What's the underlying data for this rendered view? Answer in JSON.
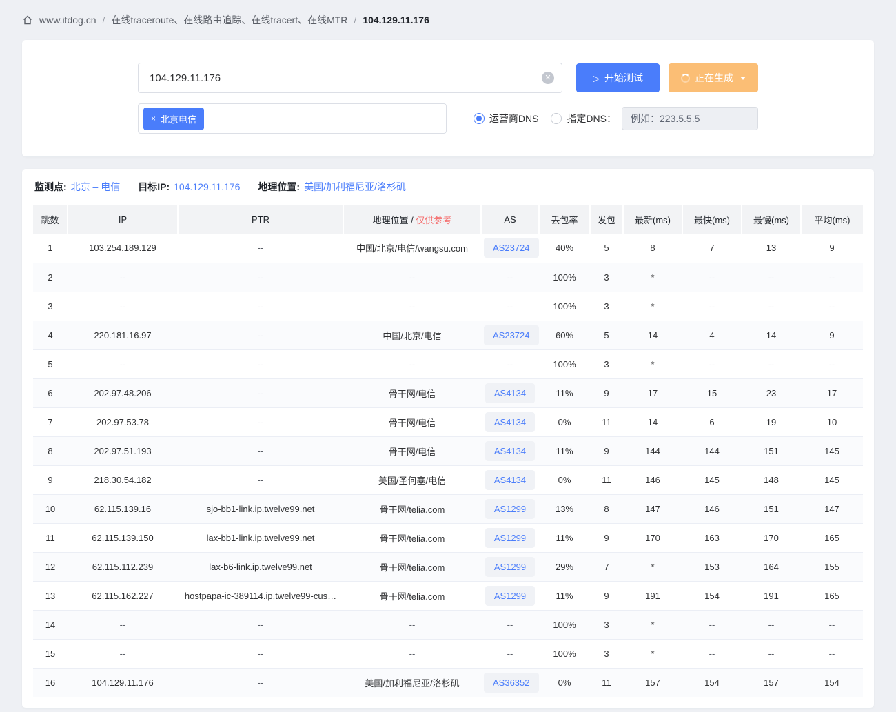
{
  "colors": {
    "primary": "#4a7dfb",
    "warning": "#fbbe75",
    "danger": "#f56c6c"
  },
  "breadcrumb": {
    "site": "www.itdog.cn",
    "separator": "/",
    "section": "在线traceroute、在线路由追踪、在线tracert、在线MTR",
    "current": "104.129.11.176"
  },
  "test_form": {
    "target_value": "104.129.11.176",
    "start_button": "开始测试",
    "generating_button": "正在生成",
    "node_tag": "北京电信",
    "tag_close": "×",
    "clear_icon": "✕",
    "play_icon": "▷",
    "dns_options": [
      {
        "label": "运营商DNS",
        "selected": true
      },
      {
        "label": "指定DNS：",
        "selected": false
      }
    ],
    "dns_placeholder": "例如：223.5.5.5"
  },
  "result_summary": {
    "monitor_label": "监测点:",
    "monitor_value": "北京 – 电信",
    "target_label": "目标IP:",
    "target_value": "104.129.11.176",
    "geo_label": "地理位置:",
    "geo_value": "美国/加利福尼亚/洛杉矶"
  },
  "table": {
    "headers": [
      {
        "label": "跳数"
      },
      {
        "label": "IP"
      },
      {
        "label": "PTR"
      },
      {
        "label": "地理位置 /",
        "note": "仅供参考"
      },
      {
        "label": "AS"
      },
      {
        "label": "丢包率"
      },
      {
        "label": "发包"
      },
      {
        "label": "最新(ms)"
      },
      {
        "label": "最快(ms)"
      },
      {
        "label": "最慢(ms)"
      },
      {
        "label": "平均(ms)"
      }
    ],
    "rows": [
      {
        "hop": "1",
        "ip": "103.254.189.129",
        "ptr": "--",
        "location": "中国/北京/电信/wangsu.com",
        "as": "AS23724",
        "loss": "40%",
        "sent": "5",
        "latest": "8",
        "fastest": "7",
        "slowest": "13",
        "avg": "9"
      },
      {
        "hop": "2",
        "ip": "--",
        "ptr": "--",
        "location": "--",
        "as": "--",
        "loss": "100%",
        "sent": "3",
        "latest": "*",
        "fastest": "--",
        "slowest": "--",
        "avg": "--"
      },
      {
        "hop": "3",
        "ip": "--",
        "ptr": "--",
        "location": "--",
        "as": "--",
        "loss": "100%",
        "sent": "3",
        "latest": "*",
        "fastest": "--",
        "slowest": "--",
        "avg": "--"
      },
      {
        "hop": "4",
        "ip": "220.181.16.97",
        "ptr": "--",
        "location": "中国/北京/电信",
        "as": "AS23724",
        "loss": "60%",
        "sent": "5",
        "latest": "14",
        "fastest": "4",
        "slowest": "14",
        "avg": "9"
      },
      {
        "hop": "5",
        "ip": "--",
        "ptr": "--",
        "location": "--",
        "as": "--",
        "loss": "100%",
        "sent": "3",
        "latest": "*",
        "fastest": "--",
        "slowest": "--",
        "avg": "--"
      },
      {
        "hop": "6",
        "ip": "202.97.48.206",
        "ptr": "--",
        "location": "骨干网/电信",
        "as": "AS4134",
        "loss": "11%",
        "sent": "9",
        "latest": "17",
        "fastest": "15",
        "slowest": "23",
        "avg": "17"
      },
      {
        "hop": "7",
        "ip": "202.97.53.78",
        "ptr": "--",
        "location": "骨干网/电信",
        "as": "AS4134",
        "loss": "0%",
        "sent": "11",
        "latest": "14",
        "fastest": "6",
        "slowest": "19",
        "avg": "10"
      },
      {
        "hop": "8",
        "ip": "202.97.51.193",
        "ptr": "--",
        "location": "骨干网/电信",
        "as": "AS4134",
        "loss": "11%",
        "sent": "9",
        "latest": "144",
        "fastest": "144",
        "slowest": "151",
        "avg": "145"
      },
      {
        "hop": "9",
        "ip": "218.30.54.182",
        "ptr": "--",
        "location": "美国/圣何塞/电信",
        "as": "AS4134",
        "loss": "0%",
        "sent": "11",
        "latest": "146",
        "fastest": "145",
        "slowest": "148",
        "avg": "145"
      },
      {
        "hop": "10",
        "ip": "62.115.139.16",
        "ptr": "sjo-bb1-link.ip.twelve99.net",
        "location": "骨干网/telia.com",
        "as": "AS1299",
        "loss": "13%",
        "sent": "8",
        "latest": "147",
        "fastest": "146",
        "slowest": "151",
        "avg": "147"
      },
      {
        "hop": "11",
        "ip": "62.115.139.150",
        "ptr": "lax-bb1-link.ip.twelve99.net",
        "location": "骨干网/telia.com",
        "as": "AS1299",
        "loss": "11%",
        "sent": "9",
        "latest": "170",
        "fastest": "163",
        "slowest": "170",
        "avg": "165"
      },
      {
        "hop": "12",
        "ip": "62.115.112.239",
        "ptr": "lax-b6-link.ip.twelve99.net",
        "location": "骨干网/telia.com",
        "as": "AS1299",
        "loss": "29%",
        "sent": "7",
        "latest": "*",
        "fastest": "153",
        "slowest": "164",
        "avg": "155"
      },
      {
        "hop": "13",
        "ip": "62.115.162.227",
        "ptr": "hostpapa-ic-389114.ip.twelve99-cus…",
        "location": "骨干网/telia.com",
        "as": "AS1299",
        "loss": "11%",
        "sent": "9",
        "latest": "191",
        "fastest": "154",
        "slowest": "191",
        "avg": "165"
      },
      {
        "hop": "14",
        "ip": "--",
        "ptr": "--",
        "location": "--",
        "as": "--",
        "loss": "100%",
        "sent": "3",
        "latest": "*",
        "fastest": "--",
        "slowest": "--",
        "avg": "--"
      },
      {
        "hop": "15",
        "ip": "--",
        "ptr": "--",
        "location": "--",
        "as": "--",
        "loss": "100%",
        "sent": "3",
        "latest": "*",
        "fastest": "--",
        "slowest": "--",
        "avg": "--"
      },
      {
        "hop": "16",
        "ip": "104.129.11.176",
        "ptr": "--",
        "location": "美国/加利福尼亚/洛杉矶",
        "as": "AS36352",
        "loss": "0%",
        "sent": "11",
        "latest": "157",
        "fastest": "154",
        "slowest": "157",
        "avg": "154"
      }
    ]
  }
}
